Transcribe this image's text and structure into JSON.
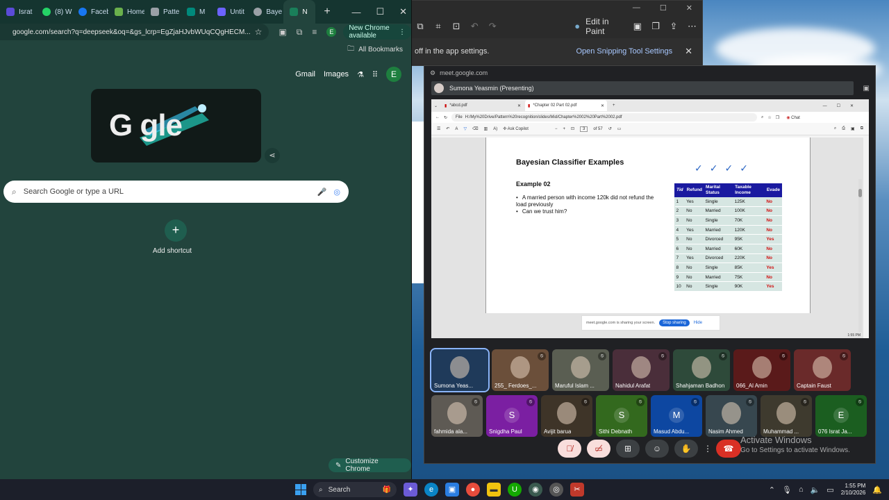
{
  "chrome": {
    "tabs": [
      {
        "label": "Israt",
        "color": "#5b4bd8"
      },
      {
        "label": "(8) W",
        "color": "#25d366"
      },
      {
        "label": "Faceb",
        "color": "#1877f2"
      },
      {
        "label": "Home",
        "color": "#6ab04c"
      },
      {
        "label": "Patte",
        "color": "#9aa0a6"
      },
      {
        "label": "M",
        "color": "#00897b"
      },
      {
        "label": "Untit",
        "color": "#6c63ff"
      },
      {
        "label": "Baye",
        "color": "#9aa0a6"
      },
      {
        "label": "N",
        "color": "#1a7f5a"
      }
    ],
    "url": "google.com/search?q=deepseek&oq=&gs_lcrp=EgZjaHJvbWUqCQgHECM...",
    "new_chrome_label": "New Chrome available",
    "all_bookmarks": "All Bookmarks",
    "ntp": {
      "gmail": "Gmail",
      "images": "Images",
      "avatar": "E",
      "doodle_text": "G     gle",
      "search_placeholder": "Search Google or type a URL",
      "add_shortcut": "Add shortcut",
      "customize": "Customize Chrome"
    }
  },
  "snip": {
    "edit_in_paint": "Edit in Paint",
    "notice_text": "off in the app settings.",
    "notice_link": "Open Snipping Tool Settings"
  },
  "meet": {
    "url": "meet.google.com",
    "presenter": "Sumona Yeasmin (Presenting)",
    "pdf": {
      "tabs": [
        "*abcd.pdf",
        "*Chapter 02 Part 02.pdf"
      ],
      "file_label": "File",
      "path": "H:/My%20Drive/Pattern%20recognition/slides/Mid/Chapter%2002%20Part%2002.pdf",
      "chat": "Chat",
      "ask_copilot": "Ask Copilot",
      "page_num": "3",
      "page_total": "of 57",
      "slide_title": "Bayesian Classifier Examples",
      "example_title": "Example 02",
      "bullets": [
        "A married person with income 120k did not refund the load previously",
        "Can we trust him?"
      ],
      "table": {
        "headers": [
          "Tid",
          "Refund",
          "Marital Status",
          "Taxable Income",
          "Evade"
        ],
        "rows": [
          [
            "1",
            "Yes",
            "Single",
            "125K",
            "No"
          ],
          [
            "2",
            "No",
            "Married",
            "100K",
            "No"
          ],
          [
            "3",
            "No",
            "Single",
            "70K",
            "No"
          ],
          [
            "4",
            "Yes",
            "Married",
            "120K",
            "No"
          ],
          [
            "5",
            "No",
            "Divorced",
            "95K",
            "Yes"
          ],
          [
            "6",
            "No",
            "Married",
            "60K",
            "No"
          ],
          [
            "7",
            "Yes",
            "Divorced",
            "220K",
            "No"
          ],
          [
            "8",
            "No",
            "Single",
            "85K",
            "Yes"
          ],
          [
            "9",
            "No",
            "Married",
            "75K",
            "No"
          ],
          [
            "10",
            "No",
            "Single",
            "90K",
            "Yes"
          ]
        ]
      },
      "sharing_text": "meet.google.com is sharing your screen.",
      "stop_sharing": "Stop sharing",
      "hide": "Hide",
      "status_time": "1:55 PM"
    },
    "participants_row1": [
      {
        "name": "Sumona Yeas...",
        "bg": "#1f3a5a"
      },
      {
        "name": "255_ Ferdoes_...",
        "bg": "#6b4f3a"
      },
      {
        "name": "Maruful Islam ...",
        "bg": "#5a5e52"
      },
      {
        "name": "Nahidul Arafat",
        "bg": "#4a2e3a"
      },
      {
        "name": "Shahjaman Badhon",
        "bg": "#2e4a3a"
      },
      {
        "name": "066_Al Amin",
        "bg": "#5a1a1a"
      },
      {
        "name": "Captain Faust",
        "bg": "#6a2a2a"
      }
    ],
    "participants_row2": [
      {
        "name": "fahmida ala...",
        "bg": "#5e5a54",
        "letter": ""
      },
      {
        "name": "Snigdha Paul",
        "bg": "#7b1fa2",
        "letter": "S"
      },
      {
        "name": "Avijit barua",
        "bg": "#3e3428",
        "letter": ""
      },
      {
        "name": "Sithi Debnath",
        "bg": "#33691e",
        "letter": "S"
      },
      {
        "name": "Masud Abdu...",
        "bg": "#0d47a1",
        "letter": "M"
      },
      {
        "name": "Nasim Ahmed",
        "bg": "#37474f",
        "letter": ""
      },
      {
        "name": "Muhammad ...",
        "bg": "#3e3a2e",
        "letter": ""
      },
      {
        "name": "076 Israt Ja...",
        "bg": "#1b5e20",
        "letter": "E"
      }
    ]
  },
  "windows": {
    "activate_title": "Activate Windows",
    "activate_sub": "Go to Settings to activate Windows."
  },
  "taskbar": {
    "search": "Search",
    "time": "1:55 PM",
    "date": "2/10/2026"
  }
}
